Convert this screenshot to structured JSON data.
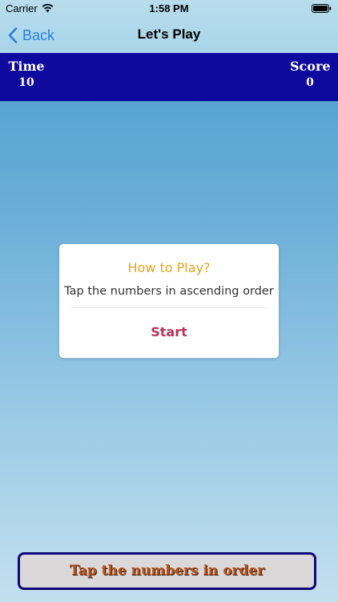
{
  "status_bar": {
    "carrier": "Carrier",
    "time": "1:58 PM"
  },
  "nav": {
    "back_label": "Back",
    "title": "Let's Play"
  },
  "score_bar": {
    "time_label": "Time",
    "time_value": "10",
    "score_label": "Score",
    "score_value": "0"
  },
  "dialog": {
    "title": "How to Play?",
    "message": "Tap the numbers in ascending order",
    "start_label": "Start"
  },
  "banner": {
    "text": "Tap the numbers in order"
  },
  "colors": {
    "accent_blue": "#2a7fd8",
    "score_bar": "#0f0a9e",
    "dialog_title": "#e3a521",
    "start_button": "#b8325a",
    "banner_text": "#b8521c"
  },
  "icons": [
    "wifi-icon",
    "battery-icon",
    "chevron-left-icon"
  ]
}
